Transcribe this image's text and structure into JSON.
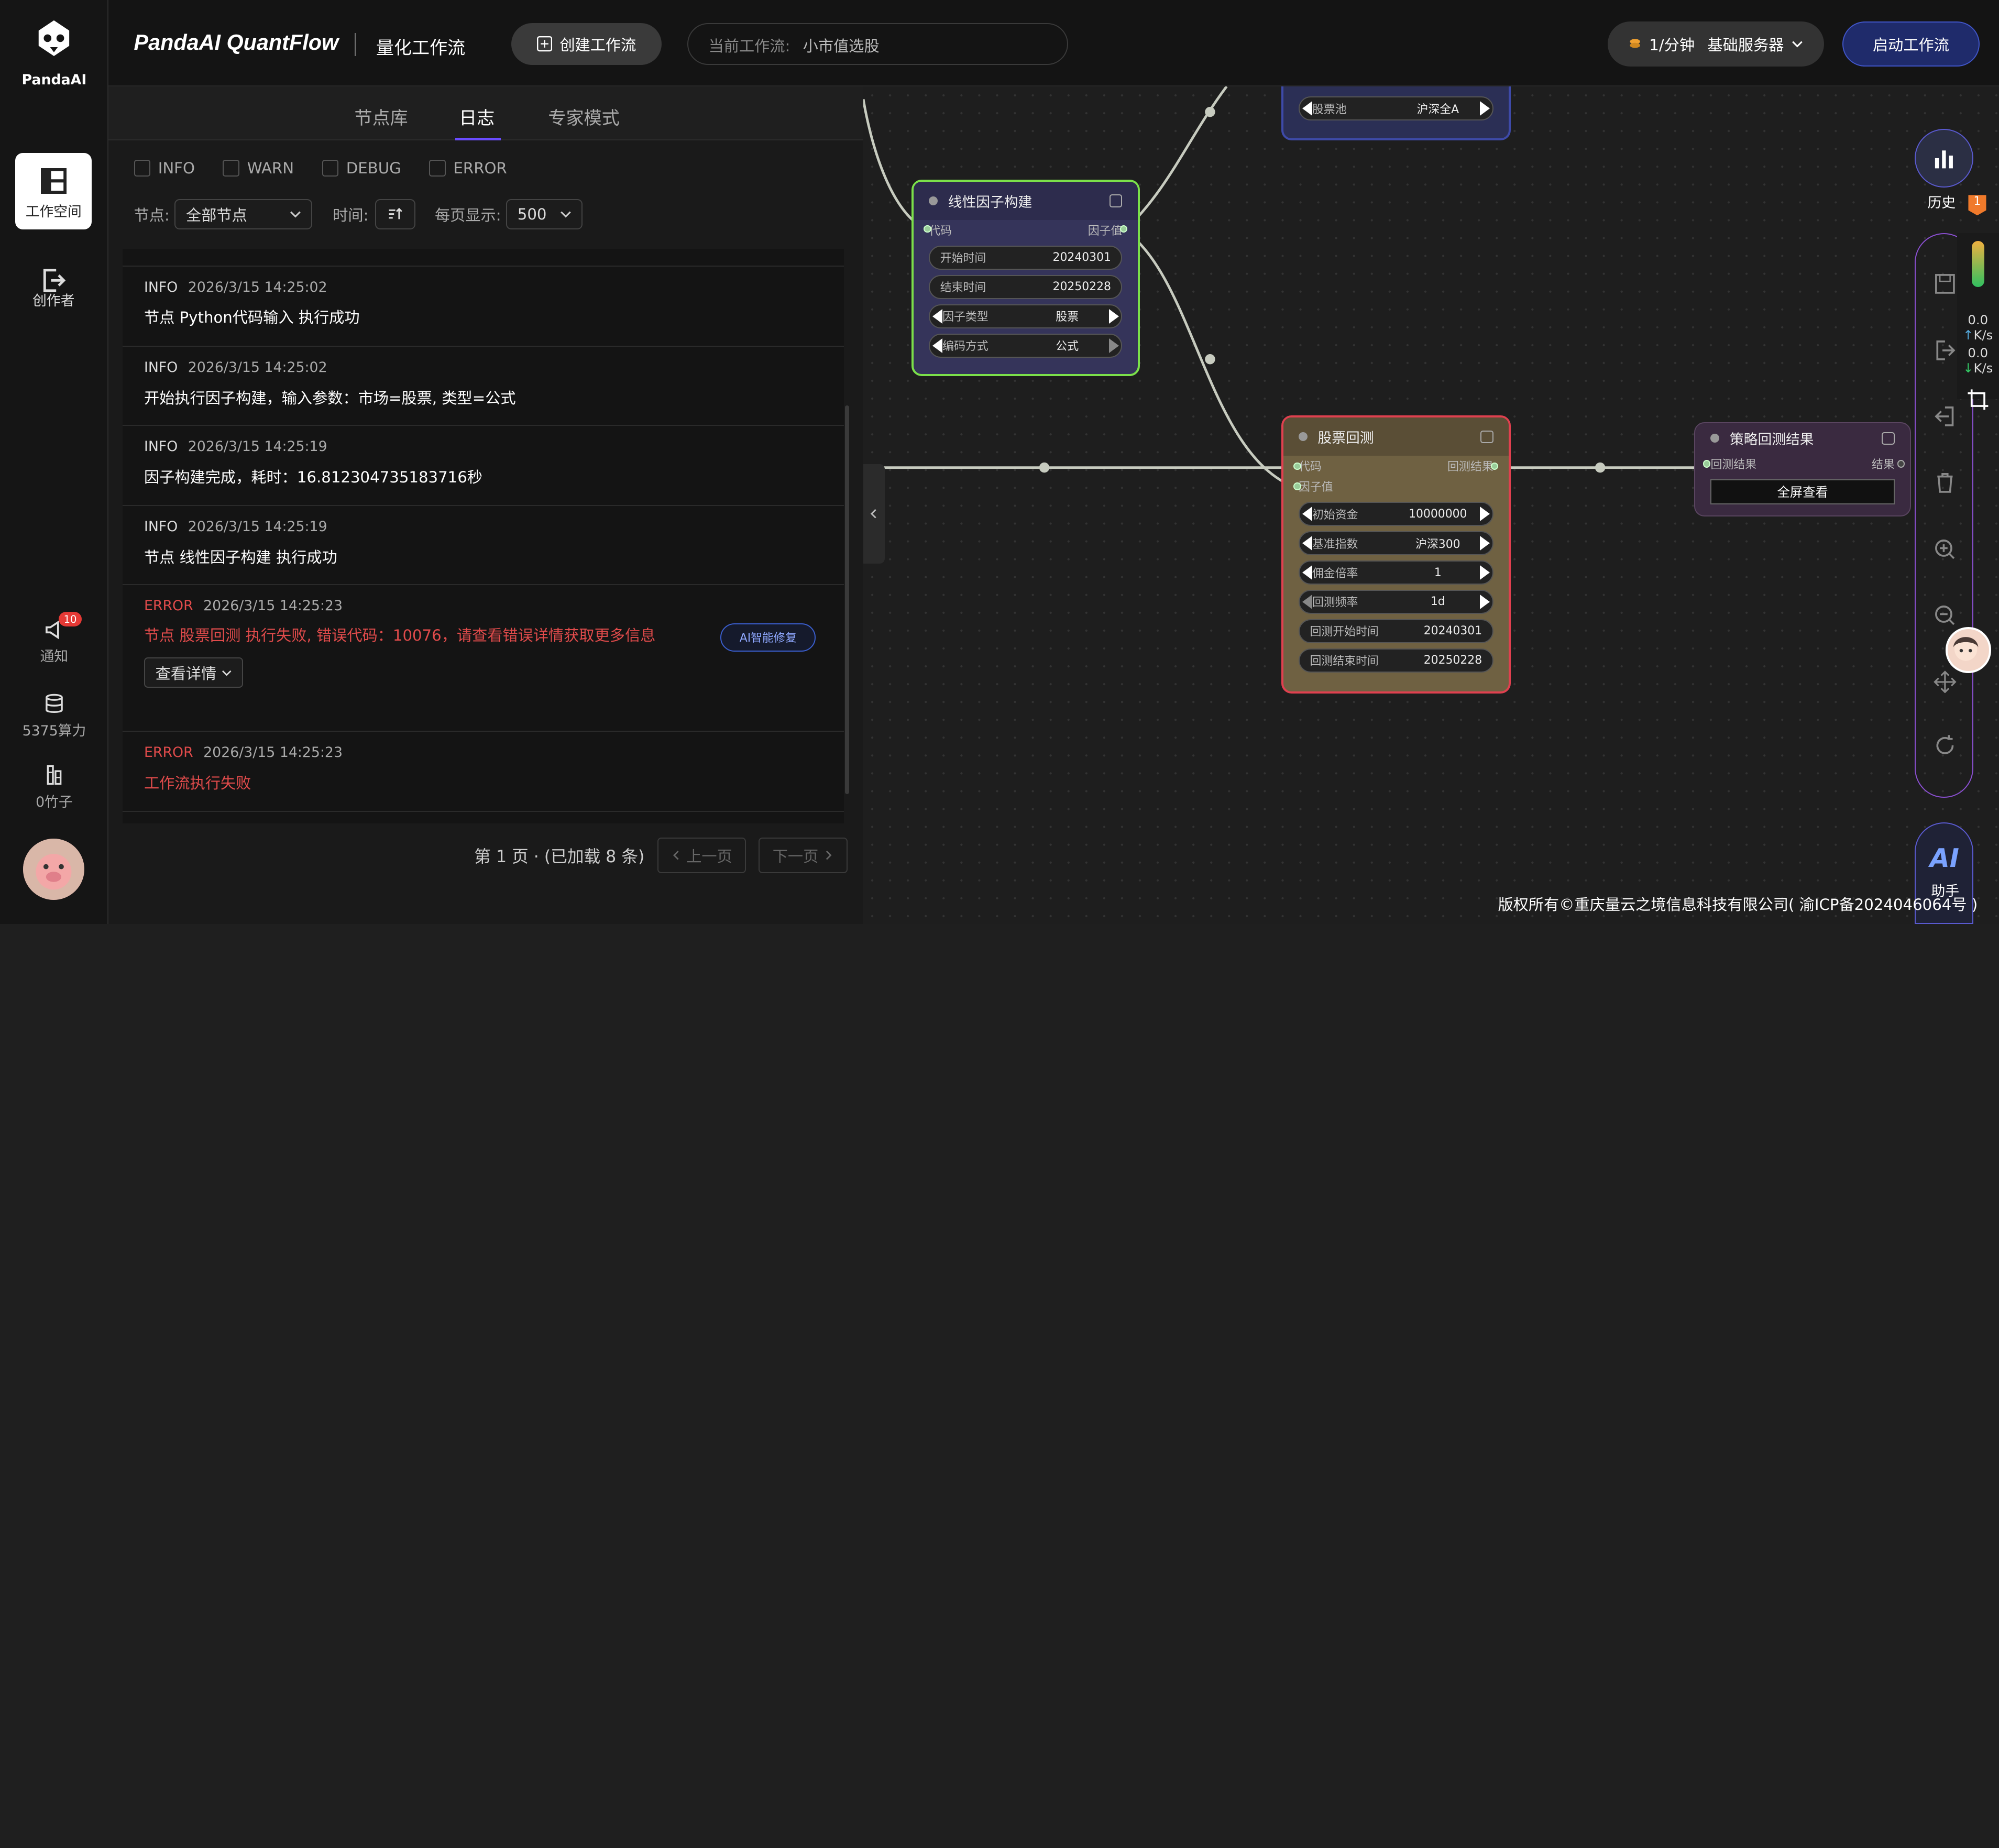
{
  "brand": {
    "logo_text": "PandaAI",
    "title": "PandaAI QuantFlow",
    "subtitle": "量化工作流"
  },
  "sidebar": {
    "items": [
      {
        "label": "工作空间",
        "icon": "layout-icon",
        "active": true
      },
      {
        "label": "创作者",
        "icon": "logout-icon"
      }
    ],
    "bottom": [
      {
        "label": "通知",
        "icon": "megaphone-icon",
        "badge": "10"
      },
      {
        "label": "5375算力",
        "icon": "database-icon"
      },
      {
        "label": "0竹子",
        "icon": "bamboo-icon"
      }
    ]
  },
  "topbar": {
    "create_label": "创建工作流",
    "current_label": "当前工作流:",
    "current_value": "小市值选股",
    "server_rate": "1/分钟",
    "server_name": "基础服务器",
    "start_label": "启动工作流"
  },
  "panel": {
    "tabs": [
      "节点库",
      "日志",
      "专家模式"
    ],
    "active_tab": "日志",
    "levels": [
      "INFO",
      "WARN",
      "DEBUG",
      "ERROR"
    ],
    "node_label": "节点:",
    "node_value": "全部节点",
    "time_label": "时间:",
    "per_page_label": "每页显示:",
    "per_page_value": "500",
    "entries": [
      {
        "level": "INFO",
        "time": "2026/3/15 14:25:02",
        "msg": "节点 Python代码输入 执行成功"
      },
      {
        "level": "INFO",
        "time": "2026/3/15 14:25:02",
        "msg": "开始执行因子构建，输入参数：市场=股票, 类型=公式"
      },
      {
        "level": "INFO",
        "time": "2026/3/15 14:25:19",
        "msg": "因子构建完成，耗时：16.812304735183716秒"
      },
      {
        "level": "INFO",
        "time": "2026/3/15 14:25:19",
        "msg": "节点 线性因子构建 执行成功"
      },
      {
        "level": "ERROR",
        "time": "2026/3/15 14:25:23",
        "msg": "节点 股票回测 执行失败, 错误代码：10076，请查看错误详情获取更多信息",
        "ai_fix": "AI智能修复",
        "detail": "查看详情"
      },
      {
        "level": "ERROR",
        "time": "2026/3/15 14:25:23",
        "msg": "工作流执行失败"
      }
    ],
    "pager_text": "第 1 页 · (已加载 8 条)",
    "prev_label": "上一页",
    "next_label": "下一页"
  },
  "nodes": {
    "factor": {
      "title": "线性因子构建",
      "in_port": "代码",
      "out_port": "因子值",
      "params": [
        {
          "k": "开始时间",
          "v": "20240301"
        },
        {
          "k": "结束时间",
          "v": "20250228"
        },
        {
          "k": "因子类型",
          "v": "股票"
        },
        {
          "k": "编码方式",
          "v": "公式"
        }
      ]
    },
    "pool": {
      "k": "股票池",
      "v": "沪深全A"
    },
    "backtest": {
      "title": "股票回测",
      "in1": "代码",
      "in2": "因子值",
      "out_port": "回测结果",
      "params": [
        {
          "k": "初始资金",
          "v": "10000000"
        },
        {
          "k": "基准指数",
          "v": "沪深300"
        },
        {
          "k": "佣金倍率",
          "v": "1"
        },
        {
          "k": "回测频率",
          "v": "1d"
        },
        {
          "k": "回测开始时间",
          "v": "20240301"
        },
        {
          "k": "回测结束时间",
          "v": "20250228"
        }
      ]
    },
    "result": {
      "title": "策略回测结果",
      "in_port": "回测结果",
      "out_port": "结果",
      "button": "全屏查看"
    }
  },
  "right": {
    "history_label": "历史",
    "warn_count": "1",
    "speed_up": "0.0",
    "speed_up_unit": "K/s",
    "speed_down": "0.0",
    "speed_down_unit": "K/s",
    "ai_icon": "AI",
    "ai_label": "助手"
  },
  "footer": {
    "copyright": "版权所有©重庆量云之境信息科技有限公司( 渝ICP备2024046064号 )"
  },
  "colors": {
    "accent": "#6a4cff",
    "error": "#e04b4b",
    "factor_border": "#7be04a",
    "backtest_border": "#e0404f",
    "result_fill": "#3a2a40"
  }
}
